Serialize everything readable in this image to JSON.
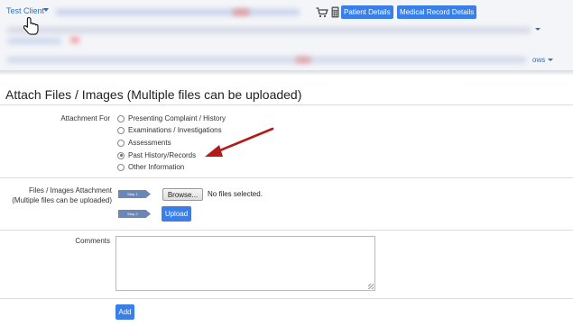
{
  "header": {
    "client_name": "Test Client",
    "patient_details_label": "Patient Details",
    "medical_record_details_label": "Medical Record Details",
    "views_label": "ows"
  },
  "page": {
    "title": "Attach Files / Images (Multiple files can be uploaded)"
  },
  "attachment_for": {
    "label": "Attachment For",
    "options": [
      {
        "label": "Presenting Complaint / History",
        "checked": false
      },
      {
        "label": "Examinations / Investigations",
        "checked": false
      },
      {
        "label": "Assessments",
        "checked": false
      },
      {
        "label": "Past History/Records",
        "checked": true
      },
      {
        "label": "Other Information",
        "checked": false
      }
    ]
  },
  "files": {
    "label_line1": "Files / Images Attachment",
    "label_line2": "(Multiple files can be uploaded)",
    "step1_label": "Step 1",
    "step2_label": "Step 2",
    "browse_label": "Browse...",
    "no_files_text": "No files selected.",
    "upload_label": "Upload"
  },
  "comments": {
    "label": "Comments",
    "value": ""
  },
  "add_label": "Add",
  "colors": {
    "accent": "#3a7ee8",
    "link": "#2f6fc3",
    "annotation_arrow": "#b31b1b"
  }
}
